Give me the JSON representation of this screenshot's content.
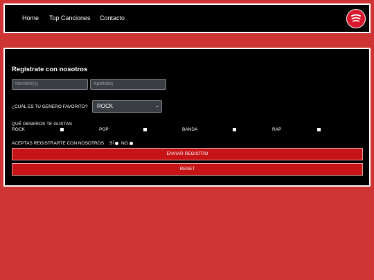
{
  "nav": {
    "links": [
      "Home",
      "Top Canciones",
      "Contacto"
    ],
    "logo_icon": "spotify-like-logo-icon"
  },
  "form": {
    "title": "Registrate con nosotros",
    "name_placeholder": "Nombre(s)",
    "lastname_placeholder": "Apellidos",
    "favorite_label": "¿CUÁL ES TU GENERO FAVORITO?",
    "favorite_value": "ROCK",
    "genres_label": "QUÉ GENEROS TE GUSTAN",
    "genres": [
      "ROCK",
      "POP",
      "BANDA",
      "RAP"
    ],
    "accept_label": "ACEPTAS REGISTRARTE CON NOSOTROS",
    "yes_label": "SÍ",
    "no_label": "NO",
    "submit_label": "ENVIAR REGISTRO",
    "reset_label": "RESET"
  },
  "colors": {
    "background": "#cf3434",
    "panel": "#000000",
    "button": "#c61416",
    "logo": "#d8162c"
  }
}
